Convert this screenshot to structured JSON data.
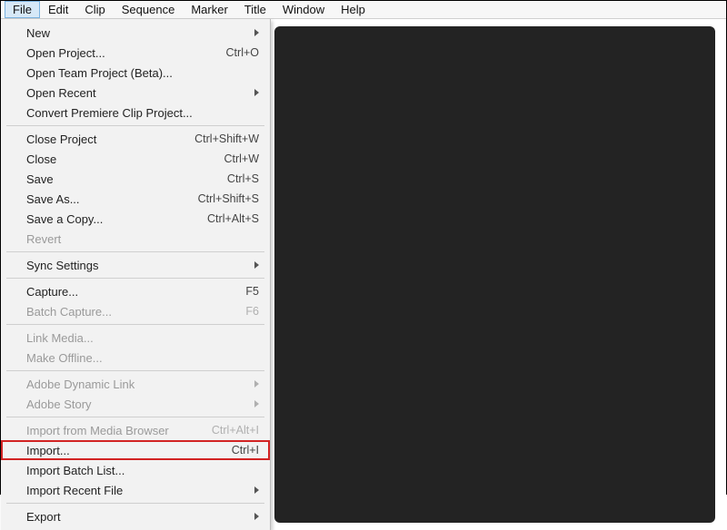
{
  "menubar": {
    "items": [
      "File",
      "Edit",
      "Clip",
      "Sequence",
      "Marker",
      "Title",
      "Window",
      "Help"
    ],
    "activeIndex": 0
  },
  "fileMenu": {
    "groups": [
      [
        {
          "label": "New",
          "shortcut": "",
          "submenu": true,
          "disabled": false,
          "highlighted": false
        },
        {
          "label": "Open Project...",
          "shortcut": "Ctrl+O",
          "submenu": false,
          "disabled": false,
          "highlighted": false
        },
        {
          "label": "Open Team Project (Beta)...",
          "shortcut": "",
          "submenu": false,
          "disabled": false,
          "highlighted": false
        },
        {
          "label": "Open Recent",
          "shortcut": "",
          "submenu": true,
          "disabled": false,
          "highlighted": false
        },
        {
          "label": "Convert Premiere Clip Project...",
          "shortcut": "",
          "submenu": false,
          "disabled": false,
          "highlighted": false
        }
      ],
      [
        {
          "label": "Close Project",
          "shortcut": "Ctrl+Shift+W",
          "submenu": false,
          "disabled": false,
          "highlighted": false
        },
        {
          "label": "Close",
          "shortcut": "Ctrl+W",
          "submenu": false,
          "disabled": false,
          "highlighted": false
        },
        {
          "label": "Save",
          "shortcut": "Ctrl+S",
          "submenu": false,
          "disabled": false,
          "highlighted": false
        },
        {
          "label": "Save As...",
          "shortcut": "Ctrl+Shift+S",
          "submenu": false,
          "disabled": false,
          "highlighted": false
        },
        {
          "label": "Save a Copy...",
          "shortcut": "Ctrl+Alt+S",
          "submenu": false,
          "disabled": false,
          "highlighted": false
        },
        {
          "label": "Revert",
          "shortcut": "",
          "submenu": false,
          "disabled": true,
          "highlighted": false
        }
      ],
      [
        {
          "label": "Sync Settings",
          "shortcut": "",
          "submenu": true,
          "disabled": false,
          "highlighted": false
        }
      ],
      [
        {
          "label": "Capture...",
          "shortcut": "F5",
          "submenu": false,
          "disabled": false,
          "highlighted": false
        },
        {
          "label": "Batch Capture...",
          "shortcut": "F6",
          "submenu": false,
          "disabled": true,
          "highlighted": false
        }
      ],
      [
        {
          "label": "Link Media...",
          "shortcut": "",
          "submenu": false,
          "disabled": true,
          "highlighted": false
        },
        {
          "label": "Make Offline...",
          "shortcut": "",
          "submenu": false,
          "disabled": true,
          "highlighted": false
        }
      ],
      [
        {
          "label": "Adobe Dynamic Link",
          "shortcut": "",
          "submenu": true,
          "disabled": true,
          "highlighted": false
        },
        {
          "label": "Adobe Story",
          "shortcut": "",
          "submenu": true,
          "disabled": true,
          "highlighted": false
        }
      ],
      [
        {
          "label": "Import from Media Browser",
          "shortcut": "Ctrl+Alt+I",
          "submenu": false,
          "disabled": true,
          "highlighted": false
        },
        {
          "label": "Import...",
          "shortcut": "Ctrl+I",
          "submenu": false,
          "disabled": false,
          "highlighted": true
        },
        {
          "label": "Import Batch List...",
          "shortcut": "",
          "submenu": false,
          "disabled": false,
          "highlighted": false
        },
        {
          "label": "Import Recent File",
          "shortcut": "",
          "submenu": true,
          "disabled": false,
          "highlighted": false
        }
      ],
      [
        {
          "label": "Export",
          "shortcut": "",
          "submenu": true,
          "disabled": false,
          "highlighted": false
        }
      ]
    ]
  }
}
